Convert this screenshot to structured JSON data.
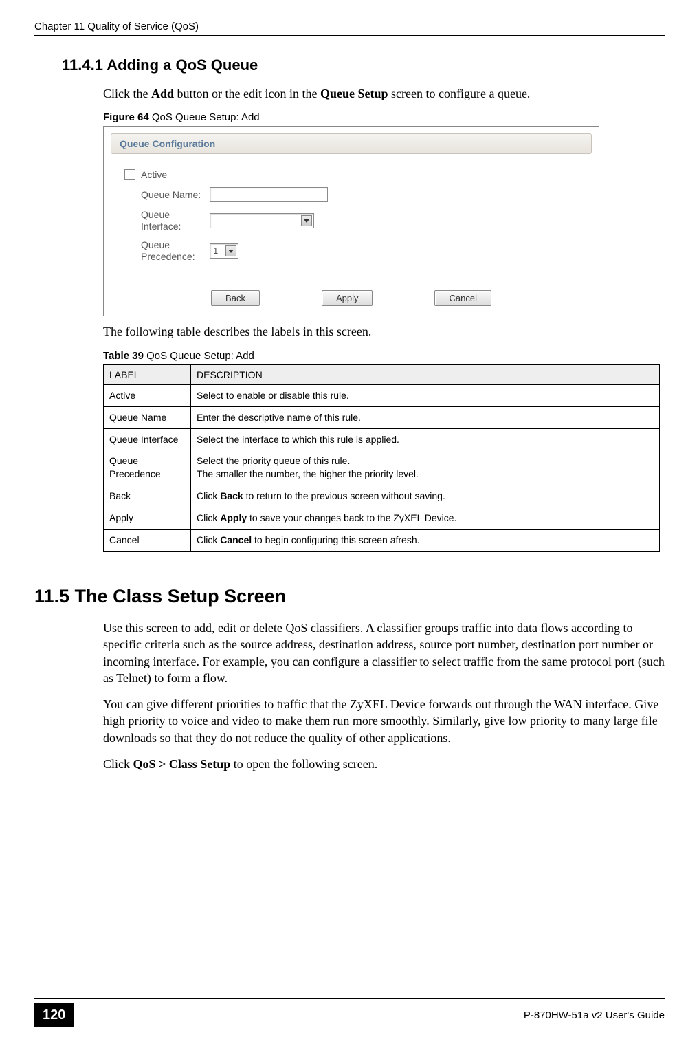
{
  "header": {
    "chapter": "Chapter 11 Quality of Service (QoS)"
  },
  "section_1": {
    "number_title": "11.4.1  Adding a QoS Queue",
    "intro_pre": "Click the ",
    "intro_b1": "Add",
    "intro_mid": " button or the edit icon in the ",
    "intro_b2": "Queue Setup",
    "intro_post": " screen to configure a queue.",
    "fig_label": "Figure 64   ",
    "fig_title": "QoS Queue Setup: Add"
  },
  "screenshot": {
    "title": "Queue Configuration",
    "active_label": "Active",
    "rows": [
      {
        "label": "Queue Name:"
      },
      {
        "label": "Queue Interface:"
      },
      {
        "label": "Queue Precedence:",
        "value": "1"
      }
    ],
    "buttons": {
      "back": "Back",
      "apply": "Apply",
      "cancel": "Cancel"
    }
  },
  "post_fig_text": "The following table describes the labels in this screen.",
  "table": {
    "caption_label": "Table 39   ",
    "caption_title": "QoS Queue Setup: Add",
    "header_label": "LABEL",
    "header_desc": "DESCRIPTION",
    "rows": [
      {
        "label": "Active",
        "desc": "Select to enable or disable this rule."
      },
      {
        "label": "Queue Name",
        "desc": "Enter the descriptive name of this rule."
      },
      {
        "label": "Queue Interface",
        "desc": "Select the interface to which this rule is applied."
      },
      {
        "label": "Queue Precedence",
        "desc": "Select the priority queue of this rule.\nThe smaller the number, the higher the priority level."
      },
      {
        "label": "Back",
        "desc_pre": "Click ",
        "desc_b": "Back",
        "desc_post": " to return to the previous screen without saving."
      },
      {
        "label": "Apply",
        "desc_pre": "Click ",
        "desc_b": "Apply",
        "desc_post": " to save your changes back to the ZyXEL Device."
      },
      {
        "label": "Cancel",
        "desc_pre": "Click ",
        "desc_b": "Cancel",
        "desc_post": " to begin configuring this screen afresh."
      }
    ]
  },
  "section_2": {
    "title": "11.5  The Class Setup Screen",
    "para1": "Use this screen to add, edit or delete QoS classifiers. A classifier groups traffic into data flows according to specific criteria such as the source address, destination address, source port number, destination port number or incoming interface. For example, you can configure a classifier to select traffic from the same protocol port (such as Telnet) to form a flow.",
    "para2": "You can give different priorities to traffic that the ZyXEL Device forwards out through the WAN interface. Give high priority to voice and video to make them run more smoothly. Similarly, give low priority to many large file downloads so that they do not reduce the quality of other applications.",
    "para3_pre": "Click ",
    "para3_b": "QoS > Class Setup",
    "para3_post": " to open the following screen."
  },
  "footer": {
    "page": "120",
    "guide": "P-870HW-51a v2 User's Guide"
  }
}
